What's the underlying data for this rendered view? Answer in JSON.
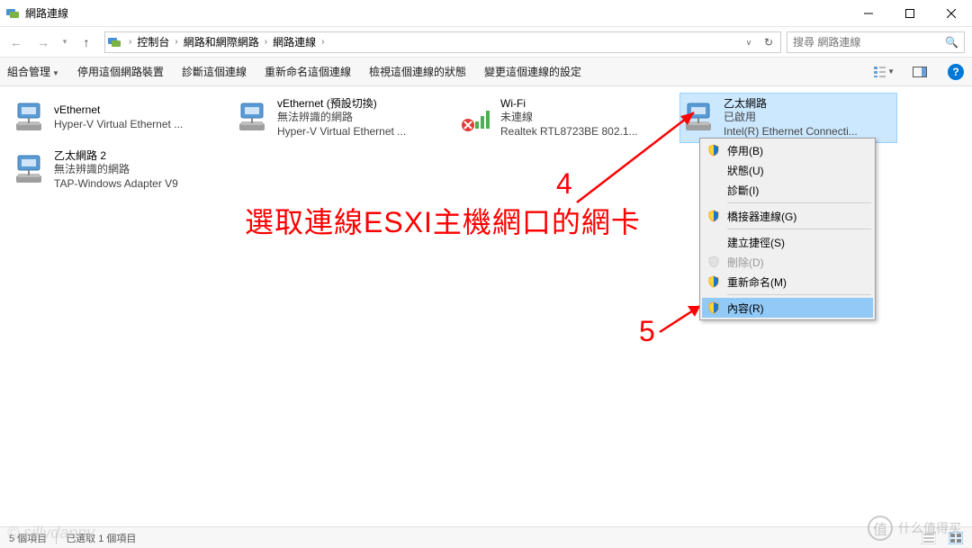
{
  "title": "網路連線",
  "breadcrumb": [
    "控制台",
    "網路和網際網路",
    "網路連線"
  ],
  "search": {
    "placeholder": "搜尋 網路連線"
  },
  "toolbar": {
    "organize": "組合管理",
    "disable": "停用這個網路裝置",
    "diagnose": "診斷這個連線",
    "rename": "重新命名這個連線",
    "status": "檢視這個連線的狀態",
    "change": "變更這個連線的設定"
  },
  "connections": [
    {
      "name": "vEthernet",
      "status": "",
      "device": "Hyper-V Virtual Ethernet ..."
    },
    {
      "name": "vEthernet (預設切換)",
      "status": "無法辨識的網路",
      "device": "Hyper-V Virtual Ethernet ..."
    },
    {
      "name": "Wi-Fi",
      "status": "未連線",
      "device": "Realtek RTL8723BE 802.1..."
    },
    {
      "name": "乙太網路",
      "status": "已啟用",
      "device": "Intel(R) Ethernet Connecti..."
    },
    {
      "name": "乙太網路 2",
      "status": "無法辨識的網路",
      "device": "TAP-Windows Adapter V9"
    }
  ],
  "contextMenu": {
    "disable": "停用(B)",
    "status": "狀態(U)",
    "diagnose": "診斷(I)",
    "bridge": "橋接器連線(G)",
    "shortcut": "建立捷徑(S)",
    "delete": "刪除(D)",
    "rename": "重新命名(M)",
    "properties": "內容(R)"
  },
  "annotations": {
    "text": "選取連線ESXI主機網口的網卡",
    "num4": "4",
    "num5": "5"
  },
  "statusbar": {
    "count": "5 個項目",
    "selected": "已選取 1 個項目"
  },
  "watermark": {
    "left": "© sillydanny",
    "right": "什么值得买",
    "brand": "值"
  }
}
